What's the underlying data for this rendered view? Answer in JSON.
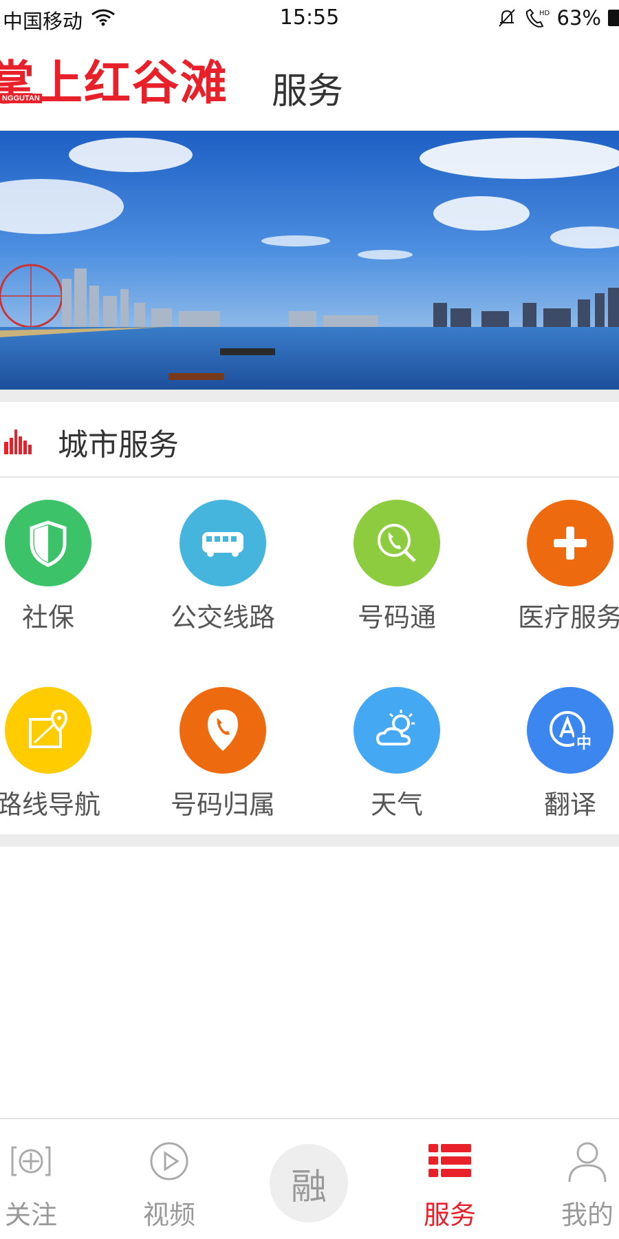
{
  "status_bar": {
    "carrier": "中国移动",
    "time": "15:55",
    "battery": "63%",
    "icons": [
      "wifi-icon",
      "bell-muted-icon",
      "hd-call-icon",
      "battery-icon"
    ]
  },
  "header": {
    "logo_text": "掌上红谷滩",
    "logo_sub": "NGGUTAN",
    "title": "服务"
  },
  "banner": {
    "icon": "city-skyline-photo"
  },
  "city_service": {
    "section_title": "城市服务",
    "items": [
      {
        "label": "社保",
        "icon": "shield-icon",
        "color": "#3cc36a"
      },
      {
        "label": "公交线路",
        "icon": "bus-icon",
        "color": "#45b5dd"
      },
      {
        "label": "号码通",
        "icon": "phone-search-icon",
        "color": "#8ccc3e"
      },
      {
        "label": "医疗服务",
        "icon": "plus-icon",
        "color": "#ee6a0e"
      },
      {
        "label": "路线导航",
        "icon": "map-pin-icon",
        "color": "#ffcc00"
      },
      {
        "label": "号码归属",
        "icon": "phone-location-icon",
        "color": "#ee6a0e"
      },
      {
        "label": "天气",
        "icon": "weather-icon",
        "color": "#45a8f2"
      },
      {
        "label": "翻译",
        "icon": "translate-icon",
        "color": "#3c86f0"
      }
    ]
  },
  "bottom_nav": {
    "items": [
      {
        "label": "关注",
        "icon": "follow-plus-icon"
      },
      {
        "label": "视频",
        "icon": "play-icon"
      },
      {
        "label": "融",
        "icon": "center-rong-button"
      },
      {
        "label": "服务",
        "icon": "service-list-icon",
        "active": true
      },
      {
        "label": "我的",
        "icon": "user-icon"
      }
    ]
  },
  "colors": {
    "accent": "#e8202a",
    "inactive": "#999999"
  }
}
